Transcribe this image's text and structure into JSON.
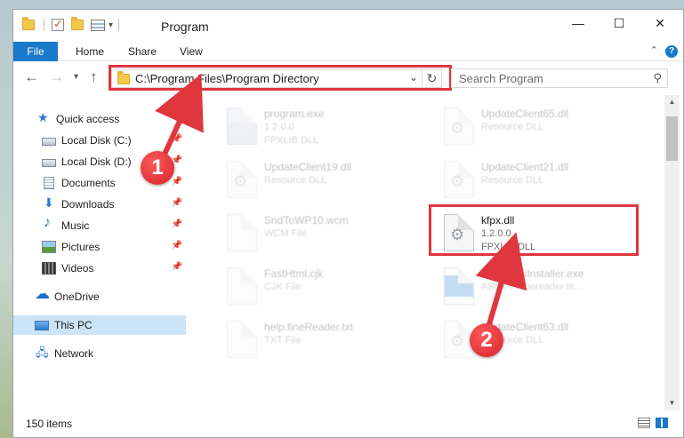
{
  "window": {
    "title": "Program",
    "controls": {
      "minimize": "—",
      "maximize": "☐",
      "close": "✕"
    },
    "quick_access_dropdown": "▾"
  },
  "ribbon": {
    "tabs": [
      "File",
      "Home",
      "Share",
      "View"
    ],
    "expand": "⌃",
    "help": "?"
  },
  "navbar": {
    "back": "←",
    "forward": "→",
    "recent": "▾",
    "up": "↑",
    "address": "C:\\Program Files\\Program Directory",
    "address_dropdown": "⌄",
    "refresh": "↻",
    "search_placeholder": "Search Program",
    "search_icon": "⚲"
  },
  "sidebar": {
    "items": [
      {
        "label": "Quick access",
        "icon": "star-icon",
        "pinned": false
      },
      {
        "label": "Local Disk (C:)",
        "icon": "drive-icon",
        "pinned": true
      },
      {
        "label": "Local Disk (D:)",
        "icon": "drive-icon",
        "pinned": true
      },
      {
        "label": "Documents",
        "icon": "documents-icon",
        "pinned": true
      },
      {
        "label": "Downloads",
        "icon": "download-icon",
        "pinned": true
      },
      {
        "label": "Music",
        "icon": "music-icon",
        "pinned": true
      },
      {
        "label": "Pictures",
        "icon": "pictures-icon",
        "pinned": true
      },
      {
        "label": "Videos",
        "icon": "videos-icon",
        "pinned": true
      },
      {
        "label": "OneDrive",
        "icon": "onedrive-icon",
        "pinned": false
      },
      {
        "label": "This PC",
        "icon": "pc-icon",
        "pinned": false,
        "selected": true
      },
      {
        "label": "Network",
        "icon": "network-icon",
        "pinned": false
      }
    ],
    "pin_glyph": "📌"
  },
  "files": [
    {
      "name": "program.exe",
      "line2": "1.2.0.0",
      "line3": "FPXLIB DLL",
      "icon": "exe-file-icon",
      "faded": true
    },
    {
      "name": "UpdateClient65.dll",
      "line2": "Resource DLL",
      "line3": "",
      "icon": "dll-file-icon",
      "faded": true
    },
    {
      "name": "UpdateClient19.dll",
      "line2": "Resource DLL",
      "line3": "",
      "icon": "dll-file-icon",
      "faded": true
    },
    {
      "name": "UpdateClient21.dll",
      "line2": "Resource DLL",
      "line3": "",
      "icon": "dll-file-icon",
      "faded": true
    },
    {
      "name": "SndToWP10.wcm",
      "line2": "WCM File",
      "line3": "",
      "icon": "generic-file-icon",
      "faded": true
    },
    {
      "name": "kfpx.dll",
      "line2": "1.2.0.0",
      "line3": "FPXLIB DLL",
      "icon": "dll-file-icon",
      "faded": false
    },
    {
      "name": "FastHtml.cjk",
      "line2": "CJK File",
      "line3": "",
      "icon": "generic-file-icon",
      "faded": true
    },
    {
      "name": "TextItemsInstaller.exe",
      "line2": "ABBYY Finereader tit...",
      "line3": "",
      "icon": "installer-file-icon",
      "faded": true
    },
    {
      "name": "help.fineReader.txt",
      "line2": "TXT File",
      "line3": "",
      "icon": "text-file-icon",
      "faded": true
    },
    {
      "name": "UpdateClient63.dll",
      "line2": "Resource DLL",
      "line3": "",
      "icon": "dll-file-icon",
      "faded": true
    }
  ],
  "status": {
    "item_count": "150 items"
  },
  "callouts": [
    "1",
    "2"
  ],
  "colors": {
    "accent": "#1979ca",
    "highlight": "#e0373e",
    "selected_bg": "#cce4f7"
  }
}
